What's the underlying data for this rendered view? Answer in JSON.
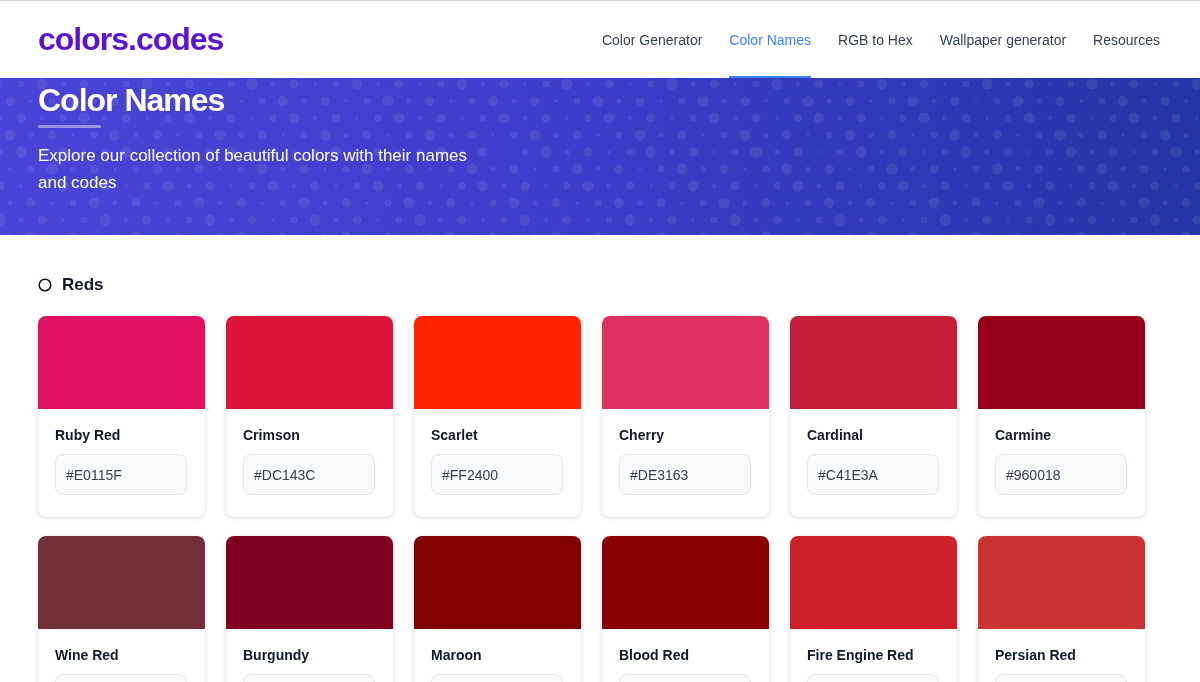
{
  "header": {
    "logo": "colors.codes",
    "nav": [
      {
        "label": "Color Generator",
        "selected": false
      },
      {
        "label": "Color Names",
        "selected": true
      },
      {
        "label": "RGB to Hex",
        "selected": false
      },
      {
        "label": "Wallpaper generator",
        "selected": false
      },
      {
        "label": "Resources",
        "selected": false
      }
    ]
  },
  "hero": {
    "title": "Color Names",
    "subtitle": "Explore our collection of beautiful colors with their names and codes"
  },
  "section": {
    "title": "Reds",
    "colors": [
      {
        "name": "Ruby Red",
        "code": "#E0115F",
        "color": "#e0115f"
      },
      {
        "name": "Crimson",
        "code": "#DC143C",
        "color": "#dc143c"
      },
      {
        "name": "Scarlet",
        "code": "#FF2400",
        "color": "#ff2400"
      },
      {
        "name": "Cherry",
        "code": "#DE3163",
        "color": "#de3163"
      },
      {
        "name": "Cardinal",
        "code": "#C41E3A",
        "color": "#c41e3a"
      },
      {
        "name": "Carmine",
        "code": "#960018",
        "color": "#960018"
      },
      {
        "name": "Wine Red",
        "color": "#722f37"
      },
      {
        "name": "Burgundy",
        "color": "#800020"
      },
      {
        "name": "Maroon",
        "color": "#800000"
      },
      {
        "name": "Blood Red",
        "color": "#8a0303"
      },
      {
        "name": "Fire Engine Red",
        "color": "#ce2029"
      },
      {
        "name": "Persian Red",
        "color": "#cc3333"
      }
    ]
  }
}
